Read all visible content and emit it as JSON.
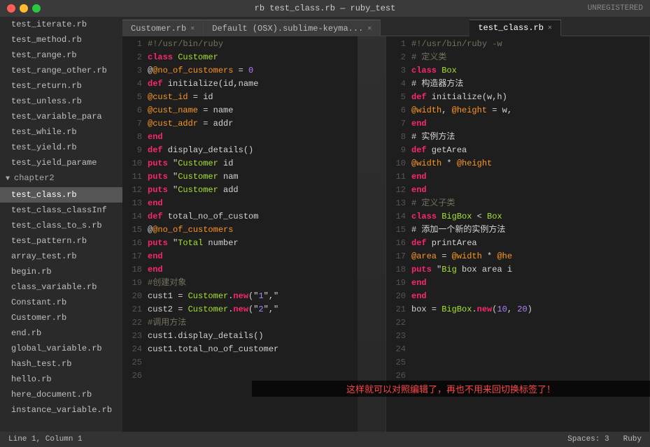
{
  "titlebar": {
    "title": "rb test_class.rb — ruby_test",
    "unregistered": "UNREGISTERED"
  },
  "sidebar": {
    "items": [
      {
        "label": "test_iterate.rb",
        "active": false
      },
      {
        "label": "test_method.rb",
        "active": false
      },
      {
        "label": "test_range.rb",
        "active": false
      },
      {
        "label": "test_range_other.rb",
        "active": false
      },
      {
        "label": "test_return.rb",
        "active": false
      },
      {
        "label": "test_unless.rb",
        "active": false
      },
      {
        "label": "test_variable_para",
        "active": false
      },
      {
        "label": "test_while.rb",
        "active": false
      },
      {
        "label": "test_yield.rb",
        "active": false
      },
      {
        "label": "test_yield_parame",
        "active": false
      },
      {
        "label": "chapter2",
        "folder": true
      },
      {
        "label": "test_class.rb",
        "active": true
      },
      {
        "label": "test_class_classInf",
        "active": false
      },
      {
        "label": "test_class_to_s.rb",
        "active": false
      },
      {
        "label": "test_pattern.rb",
        "active": false
      },
      {
        "label": "array_test.rb",
        "active": false
      },
      {
        "label": "begin.rb",
        "active": false
      },
      {
        "label": "class_variable.rb",
        "active": false
      },
      {
        "label": "Constant.rb",
        "active": false
      },
      {
        "label": "Customer.rb",
        "active": false
      },
      {
        "label": "end.rb",
        "active": false
      },
      {
        "label": "global_variable.rb",
        "active": false
      },
      {
        "label": "hash_test.rb",
        "active": false
      },
      {
        "label": "hello.rb",
        "active": false
      },
      {
        "label": "here_document.rb",
        "active": false
      },
      {
        "label": "instance_variable.rb",
        "active": false
      }
    ]
  },
  "tabs_left": [
    {
      "label": "Customer.rb",
      "active": false
    },
    {
      "label": "Default (OSX).sublime-keyma...",
      "active": false
    }
  ],
  "tabs_right": [
    {
      "label": "test_class.rb",
      "active": true
    }
  ],
  "editor_left": {
    "lines": [
      {
        "n": 1,
        "code": "#!/usr/bin/ruby"
      },
      {
        "n": 2,
        "code": "class Customer"
      },
      {
        "n": 3,
        "code": "    @@no_of_customers = 0"
      },
      {
        "n": 4,
        "code": "    def initialize(id,name"
      },
      {
        "n": 5,
        "code": "        @cust_id = id"
      },
      {
        "n": 6,
        "code": "        @cust_name = name"
      },
      {
        "n": 7,
        "code": "        @cust_addr = addr"
      },
      {
        "n": 8,
        "code": "    end"
      },
      {
        "n": 9,
        "code": "    def display_details()"
      },
      {
        "n": 10,
        "code": "        puts \"Customer id"
      },
      {
        "n": 11,
        "code": "        puts \"Customer nam"
      },
      {
        "n": 12,
        "code": "        puts \"Customer add"
      },
      {
        "n": 13,
        "code": "    end"
      },
      {
        "n": 14,
        "code": "    def total_no_of_custom"
      },
      {
        "n": 15,
        "code": "        @@no_of_customers"
      },
      {
        "n": 16,
        "code": "        puts \"Total number"
      },
      {
        "n": 17,
        "code": "    end"
      },
      {
        "n": 18,
        "code": "end"
      },
      {
        "n": 19,
        "code": ""
      },
      {
        "n": 20,
        "code": "#创建对象"
      },
      {
        "n": 21,
        "code": "cust1 = Customer.new(\"1\",\""
      },
      {
        "n": 22,
        "code": "cust2 = Customer.new(\"2\",\""
      },
      {
        "n": 23,
        "code": ""
      },
      {
        "n": 24,
        "code": "#调用方法"
      },
      {
        "n": 25,
        "code": "cust1.display_details()"
      },
      {
        "n": 26,
        "code": "cust1.total_no_of_customer"
      }
    ]
  },
  "editor_right": {
    "lines": [
      {
        "n": 1,
        "code": "#!/usr/bin/ruby -w"
      },
      {
        "n": 2,
        "code": ""
      },
      {
        "n": 3,
        "code": "# 定义类"
      },
      {
        "n": 4,
        "code": "class Box"
      },
      {
        "n": 5,
        "code": "    # 构造器方法"
      },
      {
        "n": 6,
        "code": "    def initialize(w,h)"
      },
      {
        "n": 7,
        "code": "        @width, @height = w,"
      },
      {
        "n": 8,
        "code": "    end"
      },
      {
        "n": 9,
        "code": "    # 实例方法"
      },
      {
        "n": 10,
        "code": "    def getArea"
      },
      {
        "n": 11,
        "code": "        @width * @height"
      },
      {
        "n": 12,
        "code": "    end"
      },
      {
        "n": 13,
        "code": "end"
      },
      {
        "n": 14,
        "code": ""
      },
      {
        "n": 15,
        "code": "# 定义子类"
      },
      {
        "n": 16,
        "code": "class BigBox < Box"
      },
      {
        "n": 17,
        "code": ""
      },
      {
        "n": 18,
        "code": "    # 添加一个新的实例方法"
      },
      {
        "n": 19,
        "code": "    def printArea"
      },
      {
        "n": 20,
        "code": "        @area = @width * @he"
      },
      {
        "n": 21,
        "code": "        puts \"Big box area i"
      },
      {
        "n": 22,
        "code": "    end"
      },
      {
        "n": 23,
        "code": "end"
      },
      {
        "n": 24,
        "code": ""
      },
      {
        "n": 25,
        "code": ""
      },
      {
        "n": 26,
        "code": "box = BigBox.new(10, 20)"
      }
    ]
  },
  "annotation": "这样就可以对照编辑了，再也不用来回切换标签了！",
  "status": {
    "left": "Line 1, Column 1",
    "spaces": "Spaces: 3",
    "language": "Ruby"
  }
}
